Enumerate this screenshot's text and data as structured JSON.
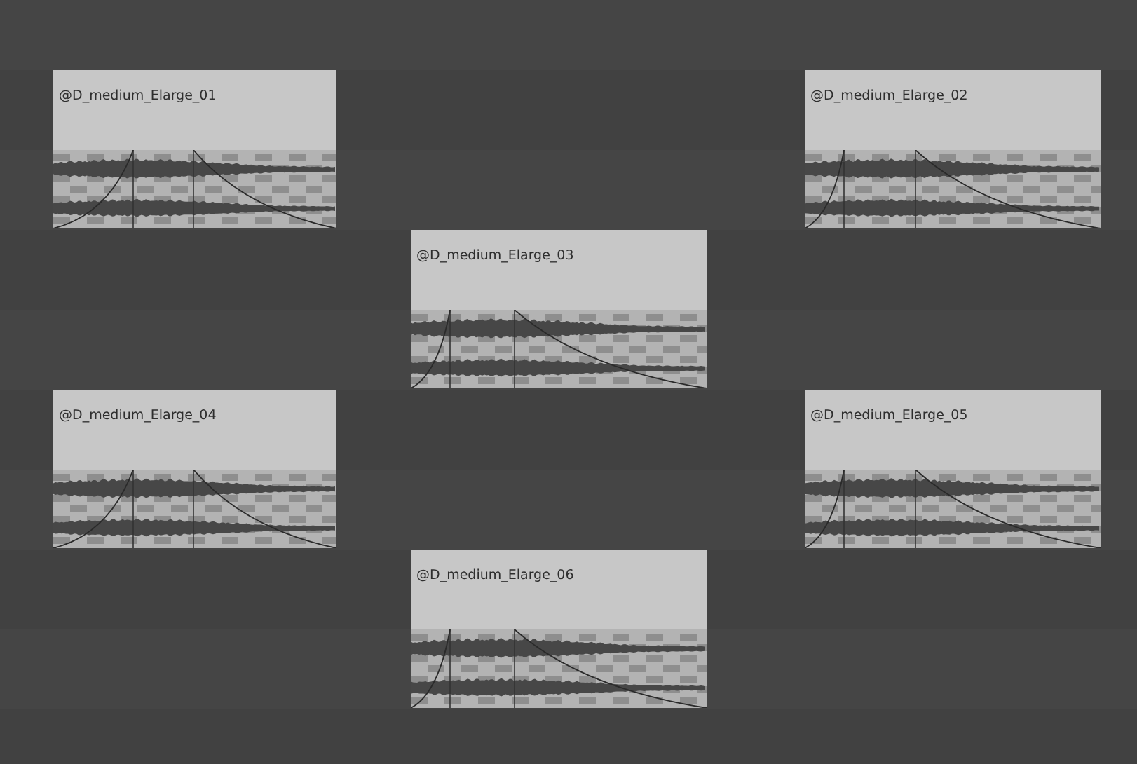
{
  "clips": [
    {
      "name": "@D_medium_Elarge_01"
    },
    {
      "name": "@D_medium_Elarge_02"
    },
    {
      "name": "@D_medium_Elarge_03"
    },
    {
      "name": "@D_medium_Elarge_04"
    },
    {
      "name": "@D_medium_Elarge_05"
    },
    {
      "name": "@D_medium_Elarge_06"
    }
  ]
}
